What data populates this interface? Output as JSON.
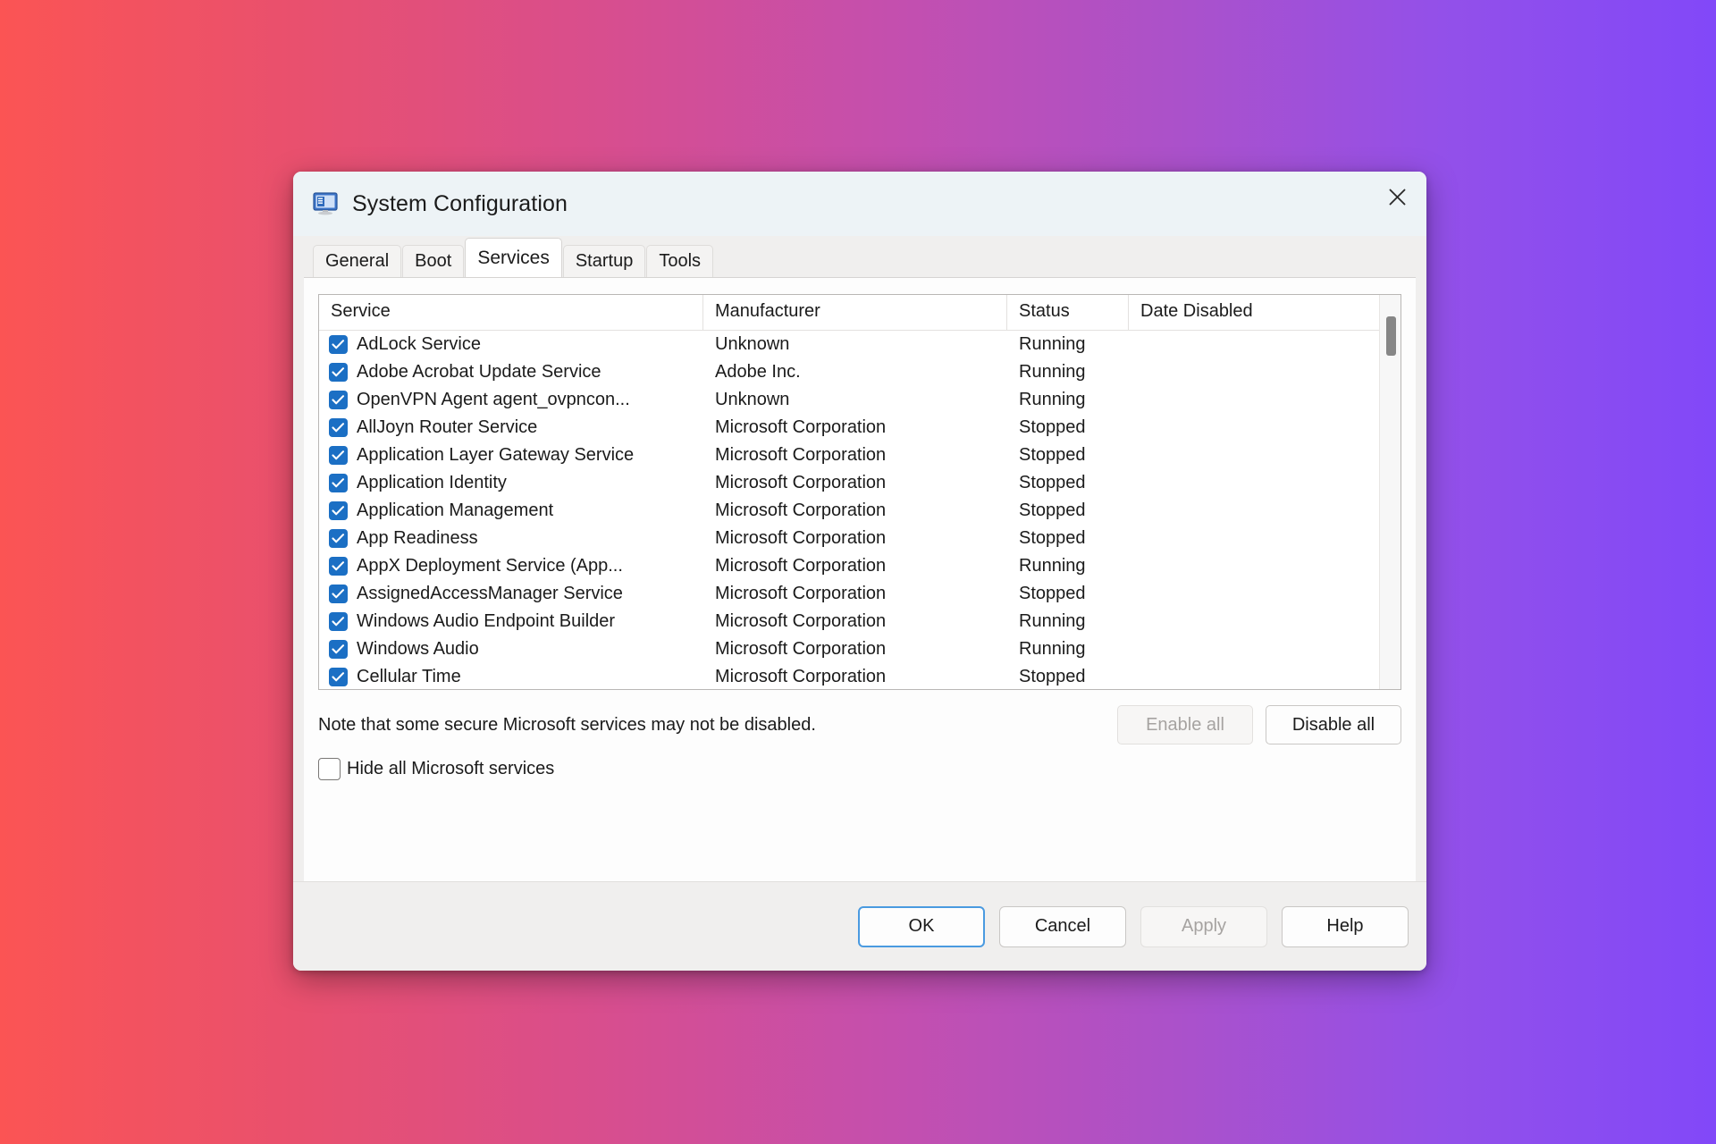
{
  "window": {
    "title": "System Configuration",
    "icon": "system-configuration-icon",
    "close_icon": "close-icon"
  },
  "tabs": [
    {
      "label": "General",
      "active": false
    },
    {
      "label": "Boot",
      "active": false
    },
    {
      "label": "Services",
      "active": true
    },
    {
      "label": "Startup",
      "active": false
    },
    {
      "label": "Tools",
      "active": false
    }
  ],
  "services_table": {
    "columns": [
      "Service",
      "Manufacturer",
      "Status",
      "Date Disabled"
    ],
    "rows": [
      {
        "checked": true,
        "service": "AdLock Service",
        "manufacturer": "Unknown",
        "status": "Running",
        "date_disabled": ""
      },
      {
        "checked": true,
        "service": "Adobe Acrobat Update Service",
        "manufacturer": "Adobe Inc.",
        "status": "Running",
        "date_disabled": ""
      },
      {
        "checked": true,
        "service": "OpenVPN Agent agent_ovpncon...",
        "manufacturer": "Unknown",
        "status": "Running",
        "date_disabled": ""
      },
      {
        "checked": true,
        "service": "AllJoyn Router Service",
        "manufacturer": "Microsoft Corporation",
        "status": "Stopped",
        "date_disabled": ""
      },
      {
        "checked": true,
        "service": "Application Layer Gateway Service",
        "manufacturer": "Microsoft Corporation",
        "status": "Stopped",
        "date_disabled": ""
      },
      {
        "checked": true,
        "service": "Application Identity",
        "manufacturer": "Microsoft Corporation",
        "status": "Stopped",
        "date_disabled": ""
      },
      {
        "checked": true,
        "service": "Application Management",
        "manufacturer": "Microsoft Corporation",
        "status": "Stopped",
        "date_disabled": ""
      },
      {
        "checked": true,
        "service": "App Readiness",
        "manufacturer": "Microsoft Corporation",
        "status": "Stopped",
        "date_disabled": ""
      },
      {
        "checked": true,
        "service": "AppX Deployment Service (App...",
        "manufacturer": "Microsoft Corporation",
        "status": "Running",
        "date_disabled": ""
      },
      {
        "checked": true,
        "service": "AssignedAccessManager Service",
        "manufacturer": "Microsoft Corporation",
        "status": "Stopped",
        "date_disabled": ""
      },
      {
        "checked": true,
        "service": "Windows Audio Endpoint Builder",
        "manufacturer": "Microsoft Corporation",
        "status": "Running",
        "date_disabled": ""
      },
      {
        "checked": true,
        "service": "Windows Audio",
        "manufacturer": "Microsoft Corporation",
        "status": "Running",
        "date_disabled": ""
      },
      {
        "checked": true,
        "service": "Cellular Time",
        "manufacturer": "Microsoft Corporation",
        "status": "Stopped",
        "date_disabled": ""
      }
    ]
  },
  "note": "Note that some secure Microsoft services may not be disabled.",
  "list_buttons": {
    "enable_all": "Enable all",
    "enable_all_disabled": true,
    "disable_all": "Disable all",
    "disable_all_disabled": false
  },
  "hide_microsoft": {
    "label": "Hide all Microsoft services",
    "checked": false
  },
  "footer_buttons": [
    {
      "label": "OK",
      "primary": true,
      "disabled": false
    },
    {
      "label": "Cancel",
      "primary": false,
      "disabled": false
    },
    {
      "label": "Apply",
      "primary": false,
      "disabled": true
    },
    {
      "label": "Help",
      "primary": false,
      "disabled": false
    }
  ],
  "colors": {
    "accent_checkbox": "#1b6fc4",
    "primary_border": "#4a9ae0",
    "titlebar_bg": "#edf3f6",
    "dialog_bg": "#f0efee",
    "background_gradient_start": "#fb5454",
    "background_gradient_end": "#8248f8"
  }
}
